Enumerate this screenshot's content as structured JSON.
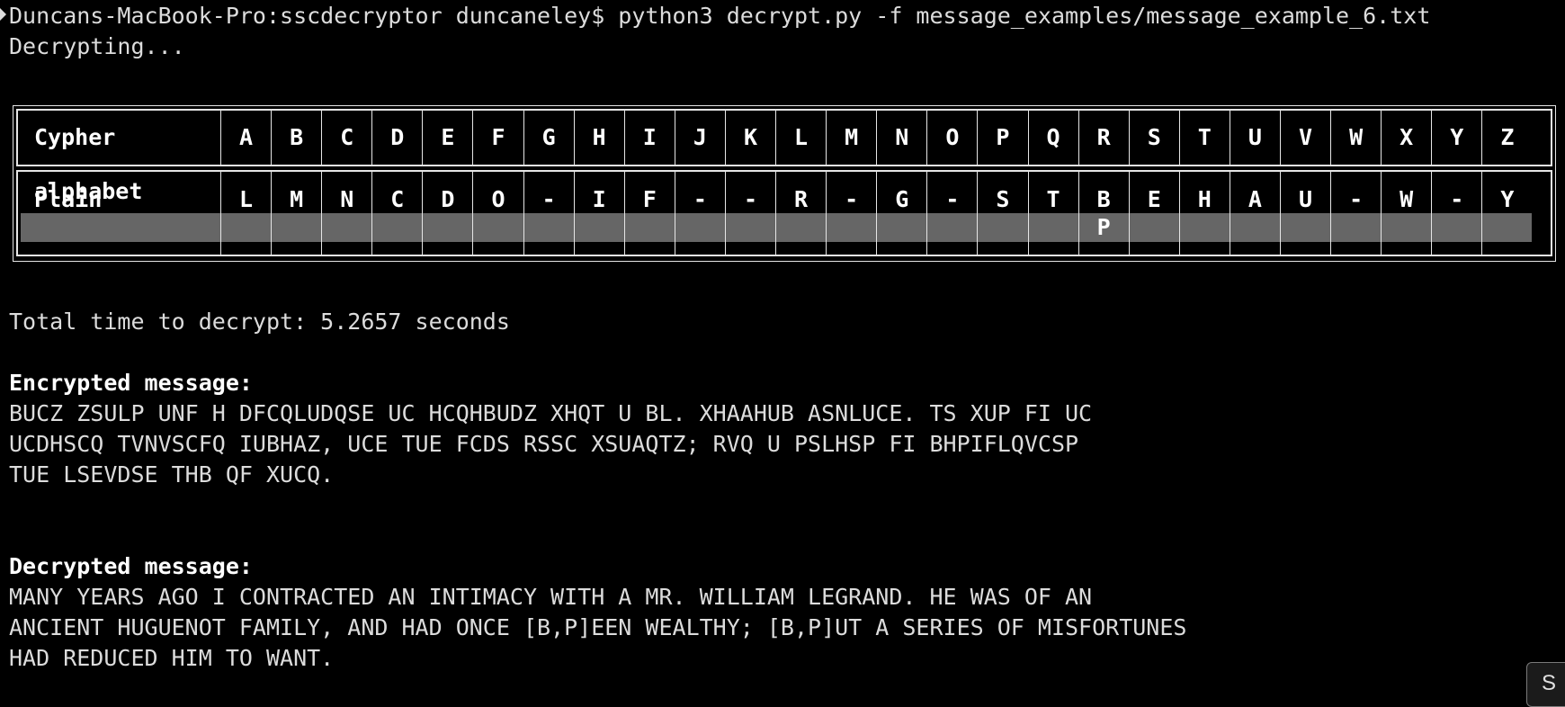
{
  "prompt": {
    "command_line": "Duncans-MacBook-Pro:sscdecryptor duncaneley$ python3 decrypt.py -f message_examples/message_example_6.txt",
    "status": "Decrypting..."
  },
  "table": {
    "cypher_label": "Cypher alphabet",
    "plain_label": "Plain alphabet",
    "cypher": [
      "A",
      "B",
      "C",
      "D",
      "E",
      "F",
      "G",
      "H",
      "I",
      "J",
      "K",
      "L",
      "M",
      "N",
      "O",
      "P",
      "Q",
      "R",
      "S",
      "T",
      "U",
      "V",
      "W",
      "X",
      "Y",
      "Z"
    ],
    "plain": [
      "L",
      "M",
      "N",
      "C",
      "D",
      "O",
      "-",
      "I",
      "F",
      "-",
      "-",
      "R",
      "-",
      "G",
      "-",
      "S",
      "T",
      "B",
      "E",
      "H",
      "A",
      "U",
      "-",
      "W",
      "-",
      "Y"
    ],
    "plain_alt": [
      "",
      "",
      "",
      "",
      "",
      "",
      "",
      "",
      "",
      "",
      "",
      "",
      "",
      "",
      "",
      "",
      "",
      "P",
      "",
      "",
      "",
      "",
      "",
      "",
      "",
      ""
    ]
  },
  "timing": "Total time to decrypt: 5.2657 seconds",
  "encrypted": {
    "heading": "Encrypted message:",
    "lines": [
      "BUCZ ZSULP UNF H DFCQLUDQSE UC HCQHBUDZ XHQT U BL. XHAAHUB ASNLUCE. TS XUP FI UC",
      "UCDHSCQ TVNVSCFQ IUBHAZ, UCE TUE FCDS RSSC XSUAQTZ; RVQ U PSLHSP FI BHPIFLQVCSP",
      "TUE LSEVDSE THB QF XUCQ."
    ]
  },
  "decrypted": {
    "heading": "Decrypted message:",
    "lines": [
      "MANY YEARS AGO I CONTRACTED AN INTIMACY WITH A MR. WILLIAM LEGRAND. HE WAS OF AN",
      "ANCIENT HUGUENOT FAMILY, AND HAD ONCE [B,P]EEN WEALTHY; [B,P]UT A SERIES OF MISFORTUNES",
      "HAD REDUCED HIM TO WANT."
    ]
  },
  "corner_button": {
    "label": "S"
  }
}
